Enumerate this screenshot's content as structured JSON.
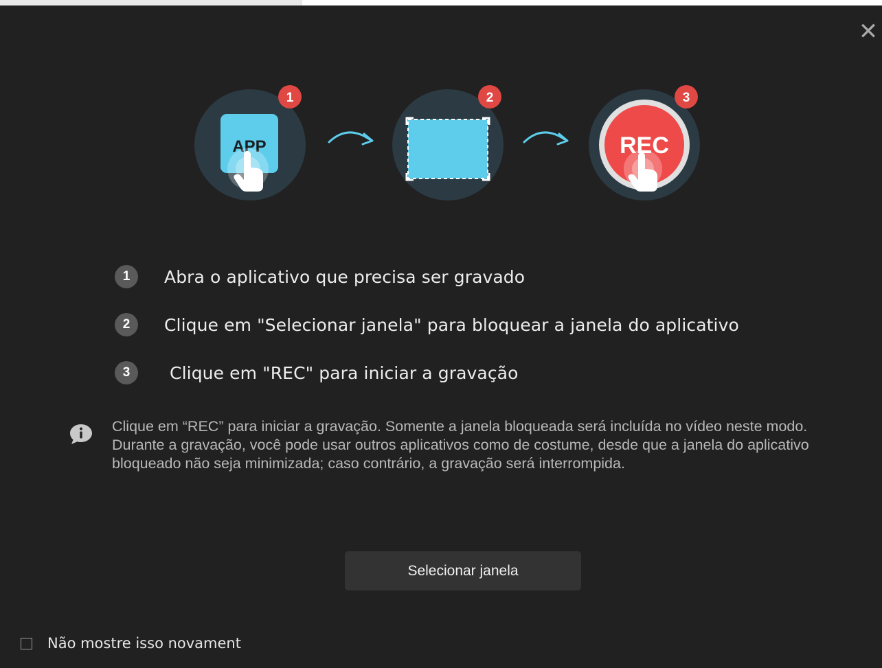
{
  "illustrations": {
    "app_label": "APP",
    "rec_label": "REC",
    "badges": [
      "1",
      "2",
      "3"
    ]
  },
  "steps": [
    {
      "num": "1",
      "text": "Abra o aplicativo que precisa ser gravado"
    },
    {
      "num": "2",
      "text": "Clique em \"Selecionar janela\" para bloquear a janela do aplicativo"
    },
    {
      "num": "3",
      "text": " Clique em \"REC\" para iniciar a gravação"
    }
  ],
  "info": {
    "icon": "info-bubble-icon",
    "text": "Clique em “REC” para iniciar a gravação. Somente a janela bloqueada será incluída no vídeo neste modo. Durante a gravação, você pode usar outros aplicativos como de costume, desde que a janela do aplicativo bloqueado não seja minimizada; caso contrário, a gravação será interrompida."
  },
  "buttons": {
    "select_window": "Selecionar janela",
    "close": "✕"
  },
  "checkbox": {
    "label": "Não mostre isso novament",
    "checked": false
  },
  "colors": {
    "background": "#212121",
    "circle": "#2b3a43",
    "badge": "#e04844",
    "accent_blue": "#5dcdeb",
    "rec_red": "#ef4a4a"
  }
}
